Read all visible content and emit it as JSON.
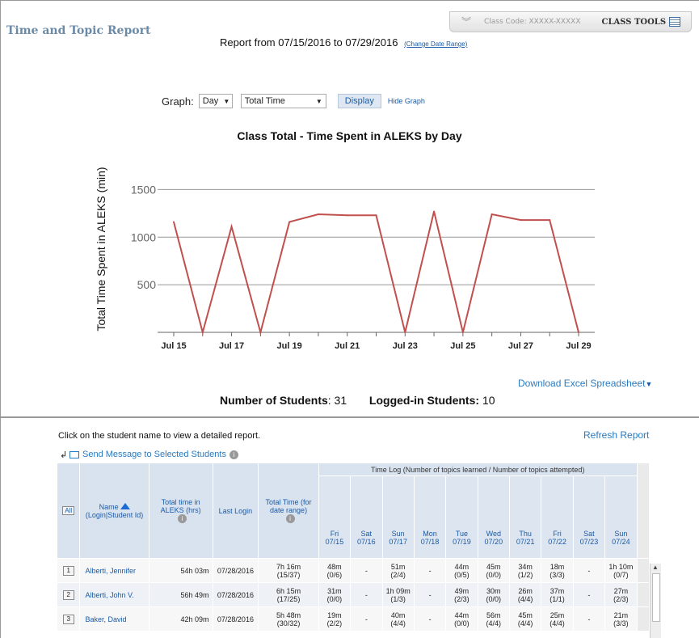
{
  "page": {
    "title": "Time and Topic Report",
    "class_code_label": "Class Code: XXXXX-XXXXX",
    "class_tools_label": "CLASS TOOLS"
  },
  "report": {
    "range_text": "Report from 07/15/2016 to 07/29/2016",
    "change_date_label": "(Change Date Range)"
  },
  "graph_controls": {
    "graph_label": "Graph:",
    "period_value": "Day",
    "metric_value": "Total Time",
    "display_label": "Display",
    "hide_graph_label": "Hide Graph"
  },
  "chart_data": {
    "type": "line",
    "title": "Class Total - Time Spent in ALEKS by Day",
    "ylabel": "Total Time Spent in ALEKS (min)",
    "xlabel": "",
    "x": [
      "Jul 15",
      "Jul 16",
      "Jul 17",
      "Jul 18",
      "Jul 19",
      "Jul 20",
      "Jul 21",
      "Jul 22",
      "Jul 23",
      "Jul 24",
      "Jul 25",
      "Jul 26",
      "Jul 27",
      "Jul 28",
      "Jul 29"
    ],
    "x_tick_labels": [
      "Jul 15",
      "Jul 17",
      "Jul 19",
      "Jul 21",
      "Jul 23",
      "Jul 25",
      "Jul 27",
      "Jul 29"
    ],
    "values": [
      1160,
      0,
      1110,
      0,
      1160,
      1240,
      1230,
      1230,
      0,
      1270,
      0,
      1240,
      1180,
      1180,
      0
    ],
    "yticks": [
      500,
      1000,
      1500
    ],
    "ylim": [
      0,
      1750
    ],
    "grid": true,
    "line_color": "#c0504d"
  },
  "links": {
    "download_excel": "Download Excel Spreadsheet",
    "refresh_report": "Refresh Report",
    "send_message": "Send Message to Selected Students"
  },
  "stats": {
    "students_label": "Number of Students",
    "students_value": ": 31",
    "logged_label": "Logged-in Students:",
    "logged_value": " 10"
  },
  "click_note": "Click on the student name to view a detailed report.",
  "table": {
    "all_label": "All",
    "name_header": "Name",
    "name_sub": "(Login|Student Id)",
    "total_time_header": "Total time in ALEKS (hrs)",
    "last_login_header": "Last Login",
    "total_range_header": "Total Time (for date range)",
    "time_log_header": "Time Log (Number of topics learned / Number of topics attempted)",
    "days": [
      {
        "dow": "Fri",
        "date": "07/15"
      },
      {
        "dow": "Sat",
        "date": "07/16"
      },
      {
        "dow": "Sun",
        "date": "07/17"
      },
      {
        "dow": "Mon",
        "date": "07/18"
      },
      {
        "dow": "Tue",
        "date": "07/19"
      },
      {
        "dow": "Wed",
        "date": "07/20"
      },
      {
        "dow": "Thu",
        "date": "07/21"
      },
      {
        "dow": "Fri",
        "date": "07/22"
      },
      {
        "dow": "Sat",
        "date": "07/23"
      },
      {
        "dow": "Sun",
        "date": "07/24"
      }
    ],
    "rows": [
      {
        "num": "1",
        "name": "Alberti, Jennifer",
        "total": "54h 03m",
        "last": "07/28/2016",
        "range_time": "7h 16m",
        "range_topics": "(15/37)",
        "cells": [
          [
            "48m",
            "(0/6)"
          ],
          [
            "-",
            ""
          ],
          [
            "51m",
            "(2/4)"
          ],
          [
            "-",
            ""
          ],
          [
            "44m",
            "(0/5)"
          ],
          [
            "45m",
            "(0/0)"
          ],
          [
            "34m",
            "(1/2)"
          ],
          [
            "18m",
            "(3/3)"
          ],
          [
            "-",
            ""
          ],
          [
            "1h 10m",
            "(0/7)"
          ]
        ]
      },
      {
        "num": "2",
        "name": "Alberti, John V.",
        "total": "56h 49m",
        "last": "07/28/2016",
        "range_time": "6h 15m",
        "range_topics": "(17/25)",
        "cells": [
          [
            "31m",
            "(0/0)"
          ],
          [
            "-",
            ""
          ],
          [
            "1h 09m",
            "(1/3)"
          ],
          [
            "-",
            ""
          ],
          [
            "49m",
            "(2/3)"
          ],
          [
            "30m",
            "(0/0)"
          ],
          [
            "26m",
            "(4/4)"
          ],
          [
            "37m",
            "(1/1)"
          ],
          [
            "-",
            ""
          ],
          [
            "27m",
            "(2/3)"
          ]
        ]
      },
      {
        "num": "3",
        "name": "Baker, David",
        "total": "42h 09m",
        "last": "07/28/2016",
        "range_time": "5h 48m",
        "range_topics": "(30/32)",
        "cells": [
          [
            "19m",
            "(2/2)"
          ],
          [
            "-",
            ""
          ],
          [
            "40m",
            "(4/4)"
          ],
          [
            "-",
            ""
          ],
          [
            "44m",
            "(0/0)"
          ],
          [
            "56m",
            "(4/4)"
          ],
          [
            "45m",
            "(4/4)"
          ],
          [
            "25m",
            "(4/4)"
          ],
          [
            "-",
            ""
          ],
          [
            "21m",
            "(3/3)"
          ]
        ]
      }
    ]
  }
}
